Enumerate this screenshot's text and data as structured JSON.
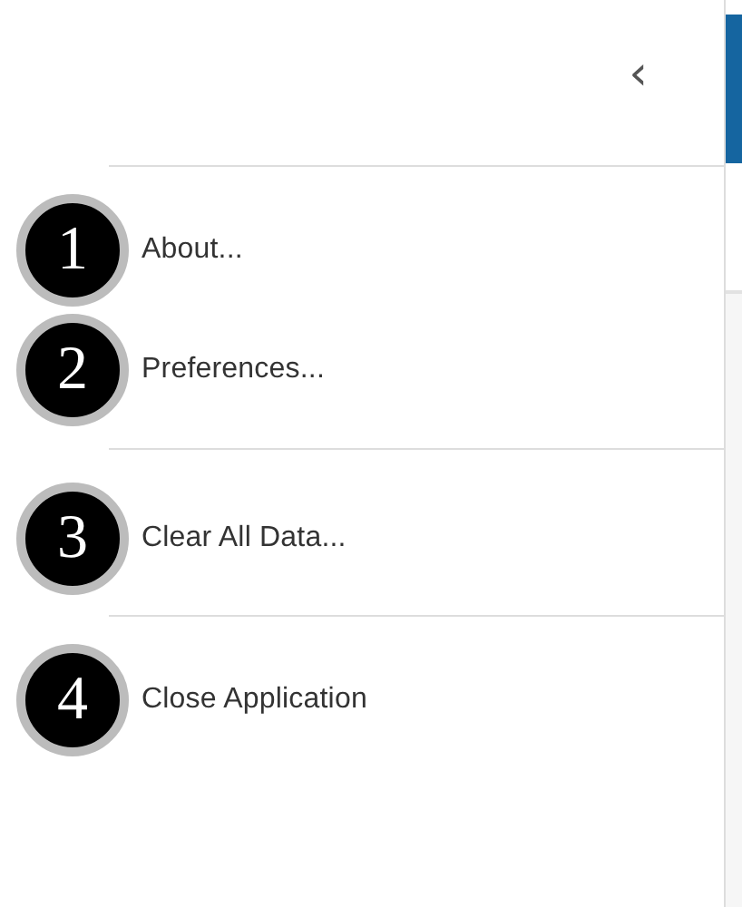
{
  "back_button": {
    "label": "‹"
  },
  "menu_groups": [
    {
      "items": [
        {
          "badge": "1",
          "label": "About..."
        },
        {
          "badge": "2",
          "label": "Preferences..."
        }
      ]
    },
    {
      "items": [
        {
          "badge": "3",
          "label": "Clear All Data..."
        }
      ]
    },
    {
      "items": [
        {
          "badge": "4",
          "label": "Close Application"
        }
      ]
    }
  ]
}
